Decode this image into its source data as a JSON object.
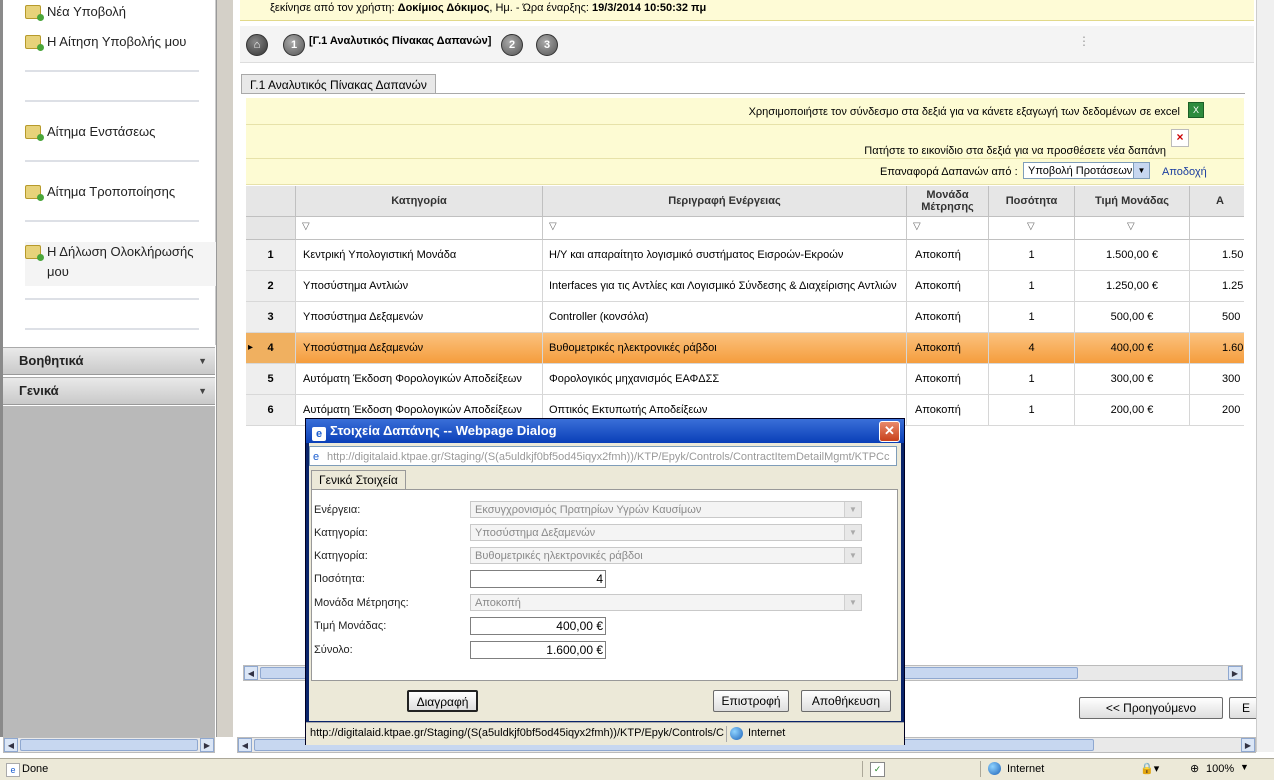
{
  "sidebar": {
    "items": [
      {
        "label": "Νέα Υποβολή"
      },
      {
        "label": "Η Αίτηση Υποβολής μου"
      },
      {
        "label": "Αίτημα Ενστάσεως"
      },
      {
        "label": "Αίτημα Τροποποίησης"
      },
      {
        "label": "Η Δήλωση Ολοκλήρωσής"
      },
      {
        "label": "μου"
      }
    ],
    "sections": [
      {
        "label": "Βοηθητικά"
      },
      {
        "label": "Γενικά"
      }
    ]
  },
  "infobar": {
    "prefix": "ξεκίνησε από τον χρήστη:",
    "user": "Δοκίμιος Δόκιμος",
    "mid": ", Ημ. - Ώρα έναρξης:",
    "datetime": "19/3/2014 10:50:32 πμ"
  },
  "steps": {
    "s1": "1",
    "s1_label": "[Γ.1 Αναλυτικός Πίνακας Δαπανών]",
    "s2": "2",
    "s3": "3"
  },
  "tab": {
    "label": "Γ.1 Αναλυτικός Πίνακας Δαπανών"
  },
  "toolbar": {
    "export_text": "Χρησιμοποιήστε τον σύνδεσμο στα δεξιά για να κάνετε εξαγωγή των δεδομένων σε excel",
    "add_text": "Πατήστε το εικονίδιο στα δεξιά για να προσθέσετε νέα δαπάνη",
    "restore_label": "Επαναφορά Δαπανών από :",
    "restore_value": "Υποβολή Προτάσεων",
    "accept_link": "Αποδοχή"
  },
  "grid": {
    "headers": [
      "Κατηγορία",
      "Περιγραφή Ενέργειας",
      "Μονάδα Μέτρησης",
      "Ποσότητα",
      "Τιμή Μονάδας",
      "Α"
    ],
    "rows": [
      {
        "n": "1",
        "cat": "Κεντρική Υπολογιστική Μονάδα",
        "desc": "Η/Υ και απαραίτητο λογισμικό συστήματος Εισροών-Εκροών",
        "unit": "Αποκοπή",
        "qty": "1",
        "price": "1.500,00 €",
        "total": "1.50"
      },
      {
        "n": "2",
        "cat": "Υποσύστημα Αντλιών",
        "desc": "Interfaces για τις Αντλίες και Λογισμικό Σύνδεσης & Διαχείρισης Αντλιών",
        "unit": "Αποκοπή",
        "qty": "1",
        "price": "1.250,00 €",
        "total": "1.25"
      },
      {
        "n": "3",
        "cat": "Υποσύστημα Δεξαμενών",
        "desc": "Controller (κονσόλα)",
        "unit": "Αποκοπή",
        "qty": "1",
        "price": "500,00 €",
        "total": "500"
      },
      {
        "n": "4",
        "cat": "Υποσύστημα Δεξαμενών",
        "desc": "Βυθομετρικές ηλεκτρονικές ράβδοι",
        "unit": "Αποκοπή",
        "qty": "4",
        "price": "400,00 €",
        "total": "1.60"
      },
      {
        "n": "5",
        "cat": "Αυτόματη Έκδοση Φορολογικών Αποδείξεων",
        "desc": "Φορολογικός μηχανισμός ΕΑΦΔΣΣ",
        "unit": "Αποκοπή",
        "qty": "1",
        "price": "300,00 €",
        "total": "300"
      },
      {
        "n": "6",
        "cat": "Αυτόματη Έκδοση Φορολογικών Αποδείξεων",
        "desc": "Οπτικός Εκτυπωτής Αποδείξεων",
        "unit": "Αποκοπή",
        "qty": "1",
        "price": "200,00 €",
        "total": "200"
      }
    ]
  },
  "nav": {
    "prev": "<< Προηγούμενο",
    "next": "Ε"
  },
  "dialog": {
    "title": "Στοιχεία Δαπάνης -- Webpage Dialog",
    "url": "http://digitalaid.ktpae.gr/Staging/(S(a5uldkjf0bf5od45iqyx2fmh))/KTP/Epyk/Controls/ContractItemDetailMgmt/KTPCc",
    "tab": "Γενικά Στοιχεία",
    "fields": {
      "action_label": "Ενέργεια:",
      "action_value": "Εκσυγχρονισμός Πρατηρίων Υγρών Καυσίμων",
      "category_label": "Κατηγορία:",
      "category_value": "Υποσύστημα Δεξαμενών",
      "category2_label": "Κατηγορία:",
      "category2_value": "Βυθομετρικές ηλεκτρονικές ράβδοι",
      "qty_label": "Ποσότητα:",
      "qty_value": "4",
      "unit_label": "Μονάδα Μέτρησης:",
      "unit_value": "Αποκοπή",
      "price_label": "Τιμή Μονάδας:",
      "price_value": "400,00 €",
      "total_label": "Σύνολο:",
      "total_value": "1.600,00 €"
    },
    "buttons": {
      "delete": "Διαγραφή",
      "back": "Επιστροφή",
      "save": "Αποθήκευση"
    },
    "status_url": "http://digitalaid.ktpae.gr/Staging/(S(a5uldkjf0bf5od45iqyx2fmh))/KTP/Epyk/Controls/C",
    "status_zone": "Internet"
  },
  "statusbar": {
    "left": "Done",
    "zone": "Internet",
    "zoom": "100%"
  }
}
